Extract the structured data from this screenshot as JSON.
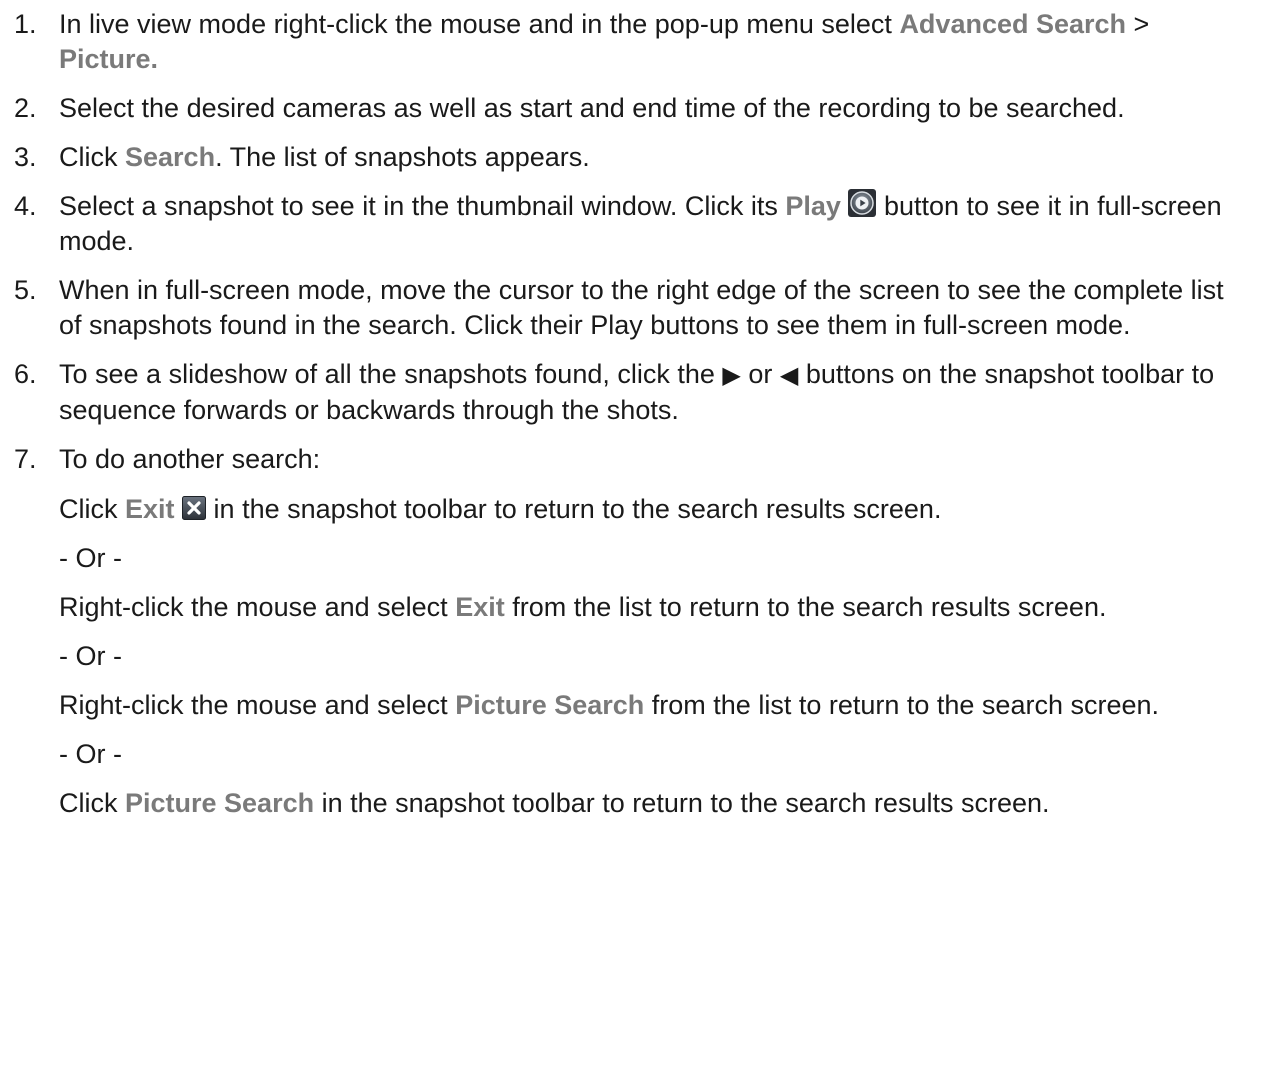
{
  "steps": [
    {
      "num": "1.",
      "text_a": "In live view mode right-click the mouse and in the pop-up menu select ",
      "kw_a": "Advanced Search",
      "text_b": " > ",
      "kw_b": "Picture."
    },
    {
      "num": "2.",
      "text_a": "Select the desired cameras as well as start and end time of the recording to be searched."
    },
    {
      "num": "3.",
      "text_a": "Click ",
      "kw_a": "Search",
      "text_b": ". The list of snapshots appears."
    },
    {
      "num": "4.",
      "text_a": "Select a snapshot to see it in the thumbnail window. Click its ",
      "kw_a": "Play",
      "text_b": " button to see it in full-screen mode."
    },
    {
      "num": "5.",
      "text_a": "When in full-screen mode, move the cursor to the right edge of the screen to see the complete list of snapshots found in the search. Click their Play buttons to see them in full-screen mode."
    },
    {
      "num": "6.",
      "text_a": "To see a slideshow of all the snapshots found, click the ",
      "glyph_a": "▶",
      "text_b": " or ",
      "glyph_b": "◀",
      "text_c": " buttons on the snapshot toolbar to sequence forwards or backwards through the shots."
    },
    {
      "num": "7.",
      "text_a": "To do another search:"
    }
  ],
  "step7_options": [
    {
      "text_a": "Click ",
      "kw": "Exit",
      "text_b": " in the snapshot toolbar to return to the search results screen."
    },
    {
      "text": "- Or -"
    },
    {
      "text_a": "Right-click the mouse and select ",
      "kw": "Exit",
      "text_b": " from the list to return to the search results screen."
    },
    {
      "text": "- Or -"
    },
    {
      "text_a": "Right-click the mouse and select ",
      "kw": "Picture Search",
      "text_b": " from the list to return to the search screen."
    },
    {
      "text": "- Or -"
    },
    {
      "text_a": "Click ",
      "kw": "Picture Search",
      "text_b": " in the snapshot toolbar to return to the search results screen."
    }
  ],
  "icons": {
    "play": "play-circle-icon",
    "exit": "close-x-icon"
  },
  "colors": {
    "keyword": "#7a7a7a",
    "text": "#1a1a1a"
  }
}
